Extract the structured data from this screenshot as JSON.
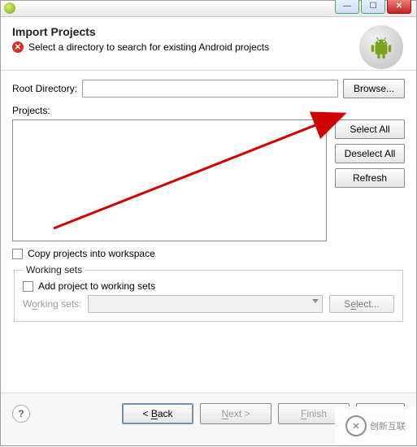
{
  "titlebar": {
    "minimize_glyph": "—",
    "maximize_glyph": "☐",
    "close_glyph": "✕"
  },
  "header": {
    "title": "Import Projects",
    "message": "Select a directory to search for existing Android projects"
  },
  "root": {
    "label": "Root Directory:",
    "value": "",
    "browse": "Browse..."
  },
  "projects": {
    "label": "Projects:",
    "select_all": "Select All",
    "deselect_all": "Deselect All",
    "refresh": "Refresh"
  },
  "copy_chk": "Copy projects into workspace",
  "working_sets": {
    "legend": "Working sets",
    "add_label": "Add project to working sets",
    "combo_label": "Working sets:",
    "select_btn": "Select..."
  },
  "footer": {
    "help": "?",
    "back": "< Back",
    "next": "Next >",
    "finish": "Finish"
  },
  "watermark": {
    "brand": "创新互联"
  }
}
